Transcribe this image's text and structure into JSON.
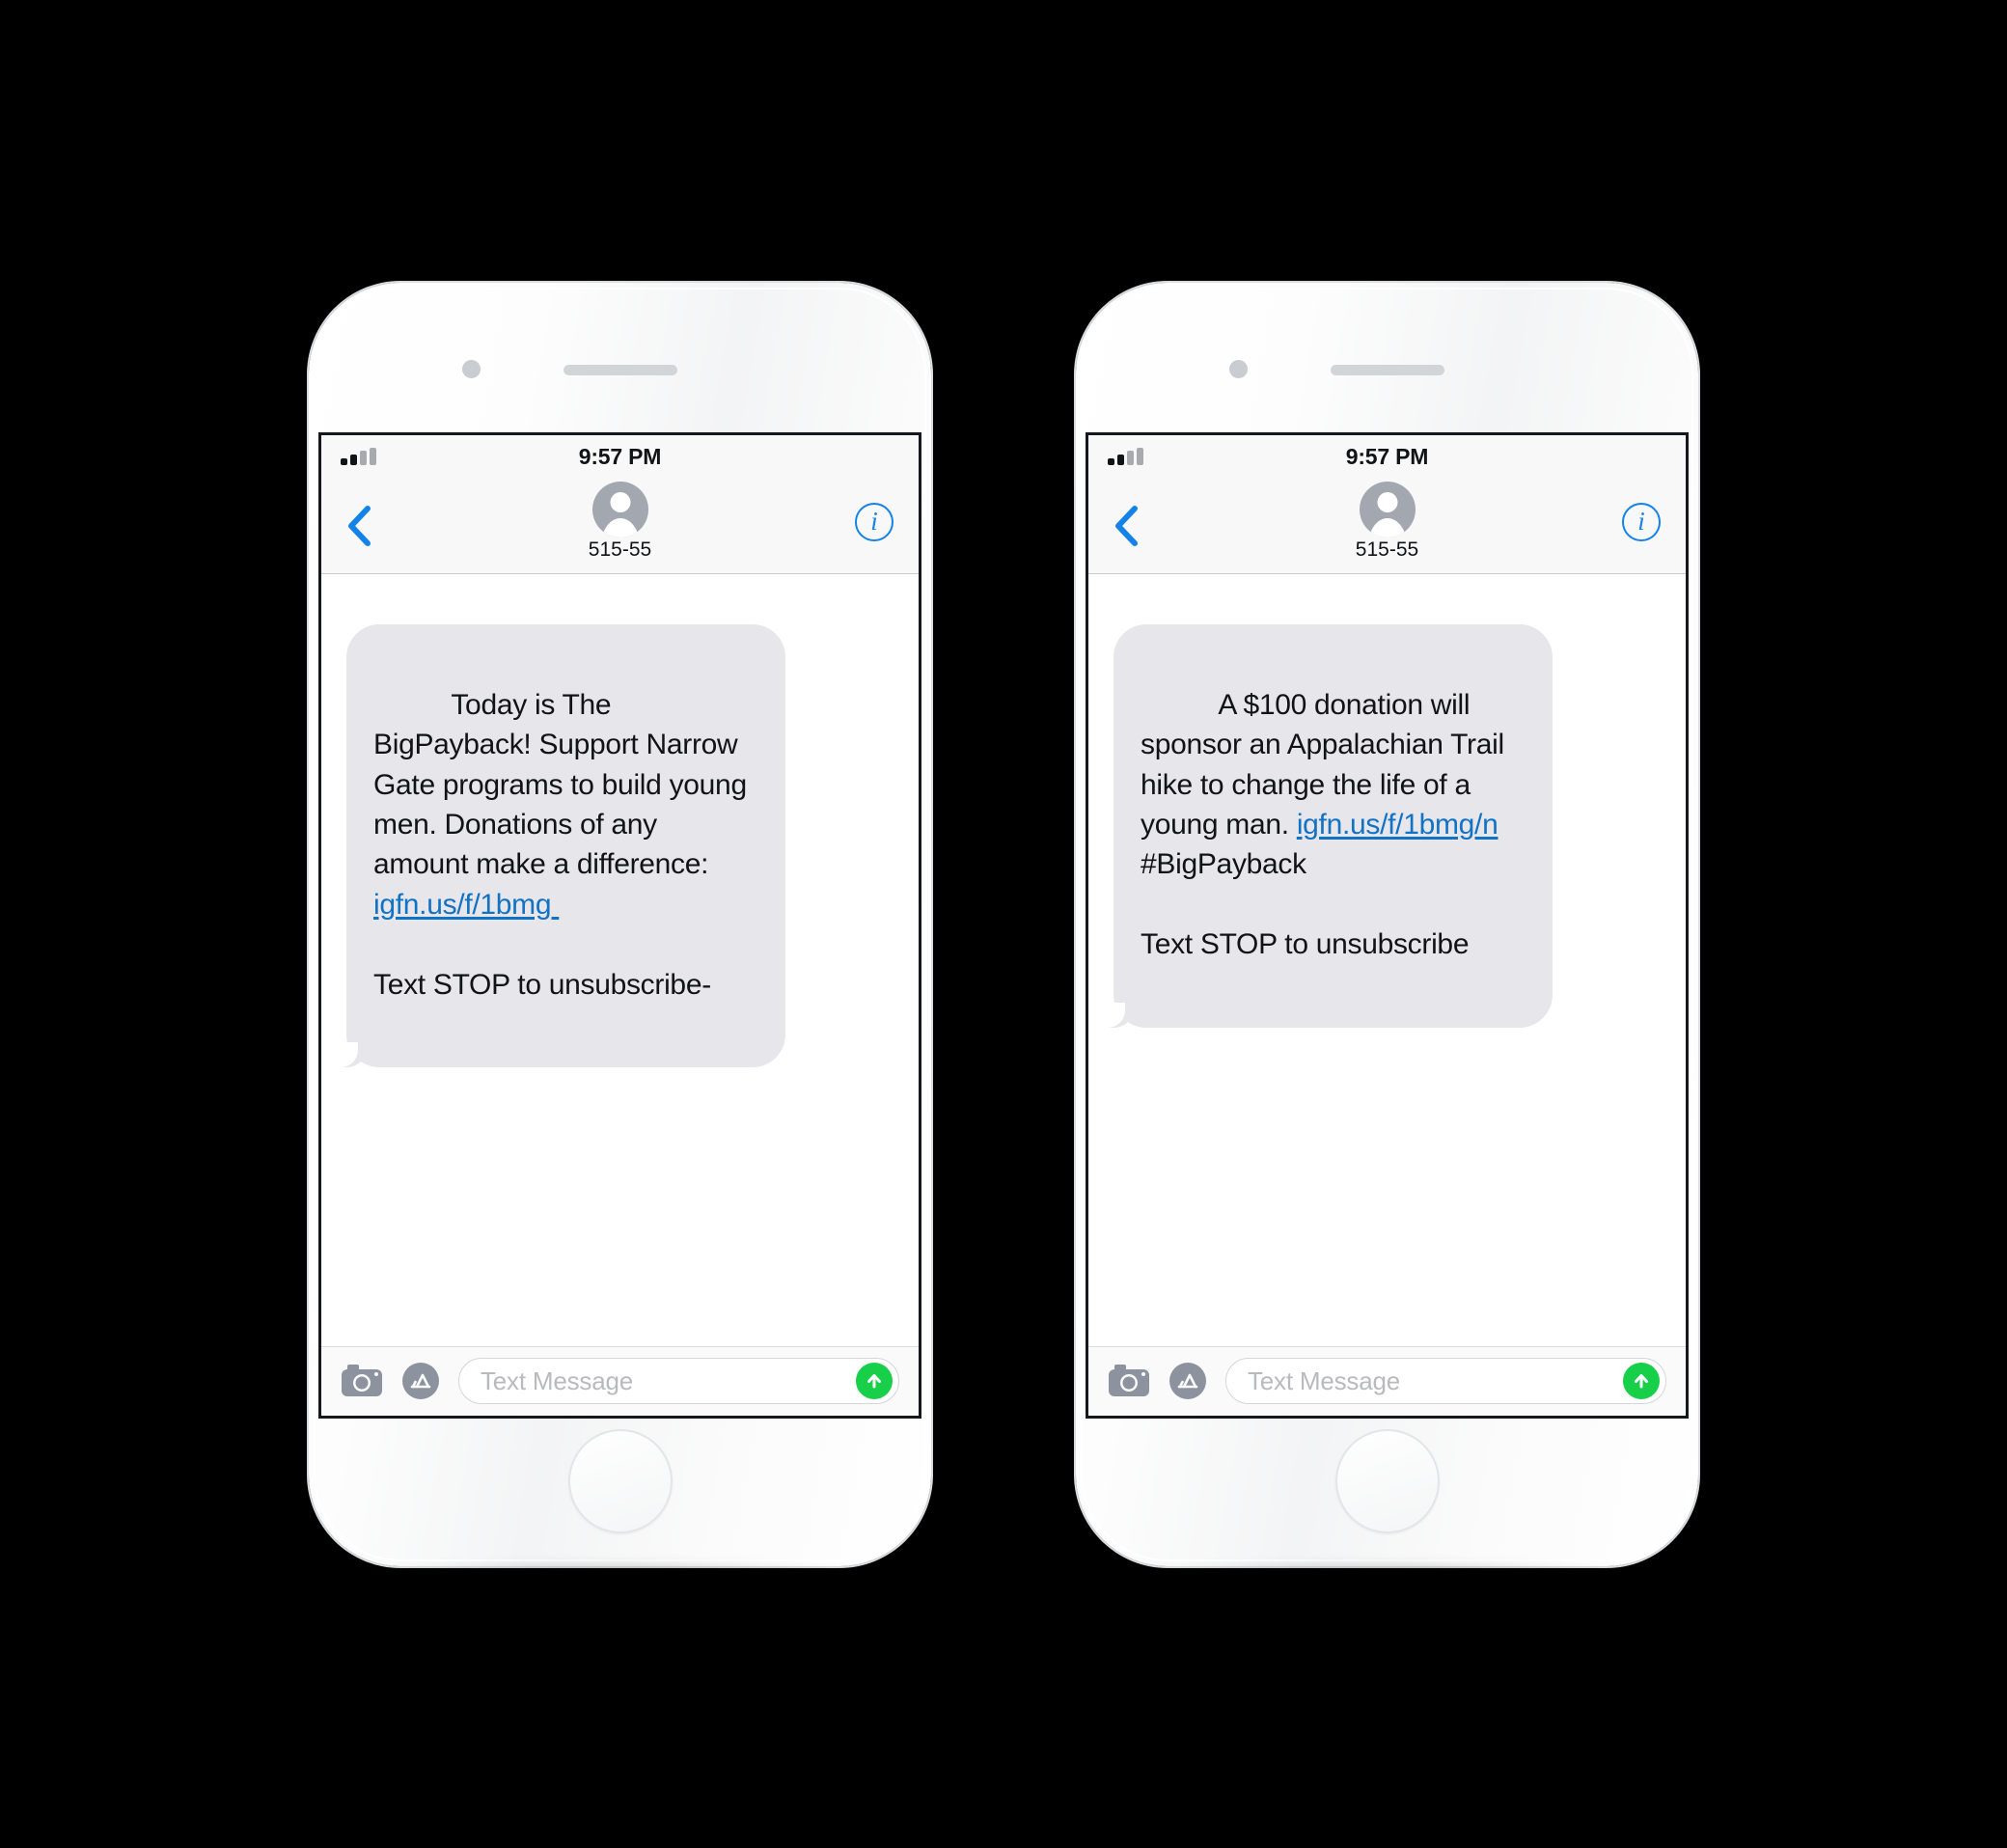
{
  "theme": {
    "bubble_bg": "#e7e6eb",
    "link_color": "#1272c4",
    "accent_blue": "#1383e8",
    "send_green": "#18cf4a",
    "screen_bg": "#ffffff",
    "chrome_bg": "#f8f8f8"
  },
  "phones": [
    {
      "status": {
        "time": "9:57 PM",
        "signal_bars_total": 4,
        "signal_bars_filled": 2
      },
      "nav": {
        "back_label": "‹",
        "contact_name": "515-55",
        "info_label": "i"
      },
      "message": {
        "segments": [
          {
            "type": "text",
            "value": "Today is The BigPayback! Support Narrow Gate programs to build young men. Donations of any amount make a difference: "
          },
          {
            "type": "link",
            "value": "igfn.us/f/1bmg "
          },
          {
            "type": "text",
            "value": "\n\nText STOP to unsubscribe-"
          }
        ],
        "plain": "Today is The BigPayback! Support Narrow Gate programs to build young men. Donations of any amount make a difference: igfn.us/f/1bmg \n\nText STOP to unsubscribe-"
      },
      "input": {
        "placeholder": "Text Message",
        "camera_icon": "camera-icon",
        "appstore_icon": "app-store-icon",
        "send_icon": "arrow-up-icon"
      }
    },
    {
      "status": {
        "time": "9:57 PM",
        "signal_bars_total": 4,
        "signal_bars_filled": 2
      },
      "nav": {
        "back_label": "‹",
        "contact_name": "515-55",
        "info_label": "i"
      },
      "message": {
        "segments": [
          {
            "type": "text",
            "value": "A $100 donation will sponsor an Appalachian Trail hike to change the life of a young man. "
          },
          {
            "type": "link",
            "value": "igfn.us/f/1bmg/n"
          },
          {
            "type": "text",
            "value": "\n#BigPayback\n\nText STOP to unsubscribe"
          }
        ],
        "plain": "A $100 donation will sponsor an Appalachian Trail hike to change the life of a young man. igfn.us/f/1bmg/n\n#BigPayback\n\nText STOP to unsubscribe"
      },
      "input": {
        "placeholder": "Text Message",
        "camera_icon": "camera-icon",
        "appstore_icon": "app-store-icon",
        "send_icon": "arrow-up-icon"
      }
    }
  ]
}
